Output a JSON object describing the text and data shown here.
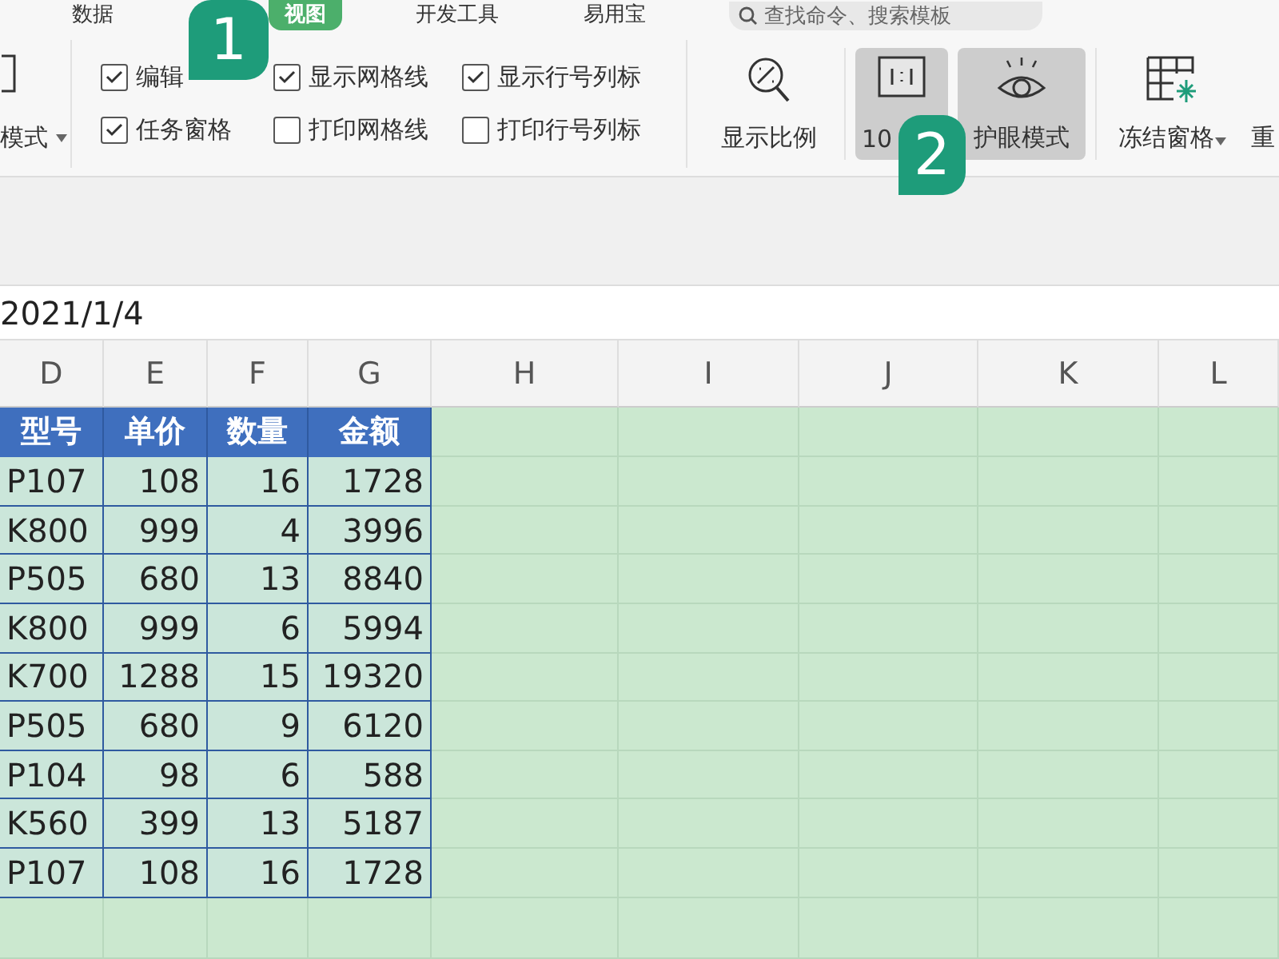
{
  "menu_tabs": [
    {
      "label": "数据",
      "selected": false
    },
    {
      "label": "视图",
      "selected": true
    },
    {
      "label": "开发工具",
      "selected": false
    },
    {
      "label": "易用宝",
      "selected": false
    }
  ],
  "search": {
    "placeholder": "查找命令、搜索模板"
  },
  "ribbon": {
    "left_button": {
      "label": "模式"
    },
    "checkboxes": [
      {
        "label": "编辑",
        "checked": true
      },
      {
        "label": "显示网格线",
        "checked": true
      },
      {
        "label": "显示行号列标",
        "checked": true
      },
      {
        "label": "任务窗格",
        "checked": true
      },
      {
        "label": "打印网格线",
        "checked": false
      },
      {
        "label": "打印行号列标",
        "checked": false
      }
    ],
    "buttons": [
      {
        "kind": "zoom",
        "label": "显示比例",
        "selected": false
      },
      {
        "kind": "actual",
        "label": "10",
        "selected": true
      },
      {
        "kind": "eye",
        "label": "护眼模式",
        "selected": true
      },
      {
        "kind": "freeze",
        "label": "冻结窗格",
        "selected": false
      },
      {
        "kind": "cut",
        "label": "重",
        "selected": false
      }
    ]
  },
  "formula_bar": {
    "value": "2021/1/4"
  },
  "columns": [
    "D",
    "E",
    "F",
    "G",
    "H",
    "I",
    "J",
    "K",
    "L"
  ],
  "table": {
    "header": [
      "型号",
      "单价",
      "数量",
      "金额"
    ],
    "rows": [
      [
        "P107",
        "108",
        "16",
        "1728"
      ],
      [
        "K800",
        "999",
        "4",
        "3996"
      ],
      [
        "P505",
        "680",
        "13",
        "8840"
      ],
      [
        "K800",
        "999",
        "6",
        "5994"
      ],
      [
        "K700",
        "1288",
        "15",
        "19320"
      ],
      [
        "P505",
        "680",
        "9",
        "6120"
      ],
      [
        "P104",
        "98",
        "6",
        "588"
      ],
      [
        "K560",
        "399",
        "13",
        "5187"
      ],
      [
        "P107",
        "108",
        "16",
        "1728"
      ]
    ]
  },
  "annotations": [
    {
      "label": "1"
    },
    {
      "label": "2"
    }
  ]
}
